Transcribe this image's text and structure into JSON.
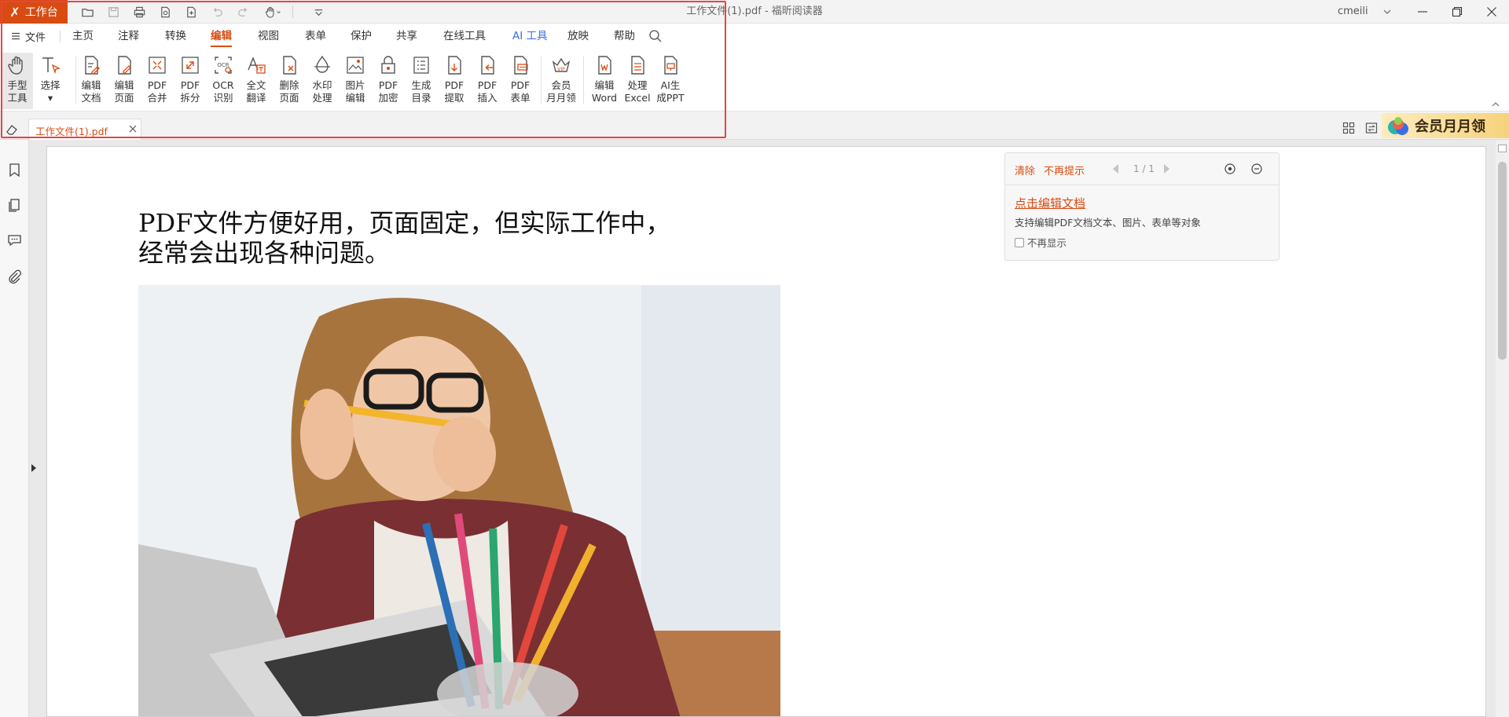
{
  "app": {
    "logo_label": "工作台",
    "window_title": "工作文件(1).pdf - 福昕阅读器",
    "user": "cmeili"
  },
  "menu": {
    "file": "文件",
    "tabs": [
      "主页",
      "注释",
      "转换",
      "编辑",
      "视图",
      "表单",
      "保护",
      "共享",
      "在线工具",
      "AI 工具",
      "放映",
      "帮助"
    ],
    "active_tab": "编辑"
  },
  "ribbon": {
    "buttons": [
      {
        "line1": "手型",
        "line2": "工具",
        "icon": "hand-icon"
      },
      {
        "line1": "选择",
        "line2": "▾",
        "icon": "select-text-icon"
      },
      {
        "line1": "编辑",
        "line2": "文档",
        "icon": "edit-document-icon"
      },
      {
        "line1": "编辑",
        "line2": "页面",
        "icon": "edit-page-icon"
      },
      {
        "line1": "PDF",
        "line2": "合并",
        "icon": "pdf-merge-icon"
      },
      {
        "line1": "PDF",
        "line2": "拆分",
        "icon": "pdf-split-icon"
      },
      {
        "line1": "OCR",
        "line2": "识别",
        "icon": "ocr-icon"
      },
      {
        "line1": "全文",
        "line2": "翻译",
        "icon": "translate-icon"
      },
      {
        "line1": "删除",
        "line2": "页面",
        "icon": "delete-page-icon"
      },
      {
        "line1": "水印",
        "line2": "处理",
        "icon": "watermark-icon"
      },
      {
        "line1": "图片",
        "line2": "编辑",
        "icon": "image-edit-icon"
      },
      {
        "line1": "PDF",
        "line2": "加密",
        "icon": "pdf-encrypt-icon"
      },
      {
        "line1": "生成",
        "line2": "目录",
        "icon": "toc-icon"
      },
      {
        "line1": "PDF",
        "line2": "提取",
        "icon": "pdf-extract-icon"
      },
      {
        "line1": "PDF",
        "line2": "插入",
        "icon": "pdf-insert-icon"
      },
      {
        "line1": "PDF",
        "line2": "表单",
        "icon": "pdf-form-icon"
      },
      {
        "line1": "会员",
        "line2": "月月领",
        "icon": "vip-icon"
      },
      {
        "line1": "编辑",
        "line2": "Word",
        "icon": "edit-word-icon"
      },
      {
        "line1": "处理",
        "line2": "Excel",
        "icon": "excel-icon"
      },
      {
        "line1": "AI生",
        "line2": "成PPT",
        "icon": "ai-ppt-icon"
      }
    ]
  },
  "document_tab": {
    "label": "工作文件(1).pdf"
  },
  "vip_banner": {
    "label": "会员月月领"
  },
  "document": {
    "heading_line1": "PDF文件方便好用，页面固定，但实际工作中，",
    "heading_line2": "经常会出现各种问题。"
  },
  "tip_panel": {
    "clear": "清除",
    "no_prompt": "不再提示",
    "page_indicator": "1 / 1",
    "link": "点击编辑文档",
    "description": "支持编辑PDF文档文本、图片、表单等对象",
    "checkbox_label": "不再显示"
  },
  "colors": {
    "accent": "#d84c12",
    "highlight_border": "#e8424a",
    "ai_tab": "#3a6ee8"
  }
}
